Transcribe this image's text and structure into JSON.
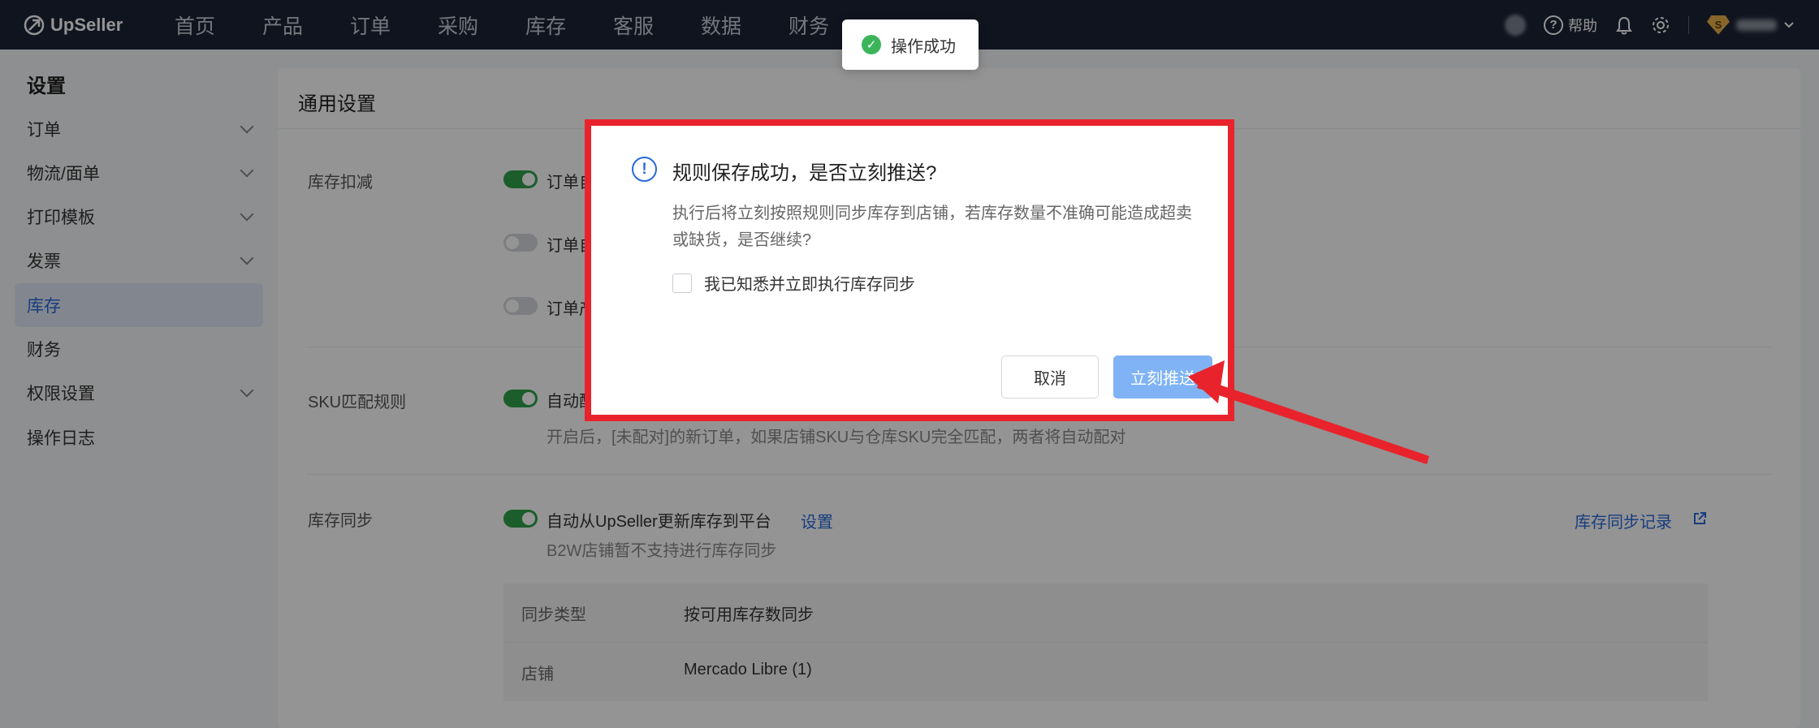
{
  "brand": {
    "name": "UpSeller"
  },
  "nav": {
    "items": [
      "首页",
      "产品",
      "订单",
      "采购",
      "库存",
      "客服",
      "数据",
      "财务"
    ],
    "help_label": "帮助"
  },
  "toast": {
    "text": "操作成功"
  },
  "sidebar": {
    "title": "设置",
    "items": [
      {
        "label": "订单",
        "expandable": true
      },
      {
        "label": "物流/面单",
        "expandable": true
      },
      {
        "label": "打印模板",
        "expandable": true
      },
      {
        "label": "发票",
        "expandable": true
      },
      {
        "label": "库存",
        "active": true
      },
      {
        "label": "财务"
      },
      {
        "label": "权限设置",
        "expandable": true
      },
      {
        "label": "操作日志"
      }
    ]
  },
  "content": {
    "title": "通用设置",
    "stock_deduct": {
      "label": "库存扣减",
      "options": [
        {
          "text": "订单自",
          "on": true
        },
        {
          "text": "订单自",
          "on": false
        },
        {
          "text": "订单产",
          "on": false
        }
      ]
    },
    "sku_match": {
      "label": "SKU匹配规则",
      "option_text": "自动配",
      "on": true,
      "desc": "开启后，[未配对]的新订单，如果店铺SKU与仓库SKU完全匹配，两者将自动配对"
    },
    "stock_sync": {
      "label": "库存同步",
      "option_text": "自动从UpSeller更新库存到平台",
      "on": true,
      "settings_link": "设置",
      "note": "B2W店铺暂不支持进行库存同步",
      "records_link": "库存同步记录",
      "table": [
        {
          "key": "同步类型",
          "value": "按可用库存数同步"
        },
        {
          "key": "店铺",
          "value": "Mercado Libre (1)"
        }
      ]
    }
  },
  "dialog": {
    "title": "规则保存成功，是否立刻推送?",
    "body": "执行后将立刻按照规则同步库存到店铺，若库存数量不准确可能造成超卖或缺货，是否继续?",
    "checkbox_label": "我已知悉并立即执行库存同步",
    "cancel_label": "取消",
    "confirm_label": "立刻推送"
  },
  "colors": {
    "nav_bg": "#1c2436",
    "accent": "#2a6ad9",
    "toggle_on": "#2fa14a",
    "annotation_red": "#e8232b",
    "primary_button_disabled": "#7fb3f5"
  }
}
